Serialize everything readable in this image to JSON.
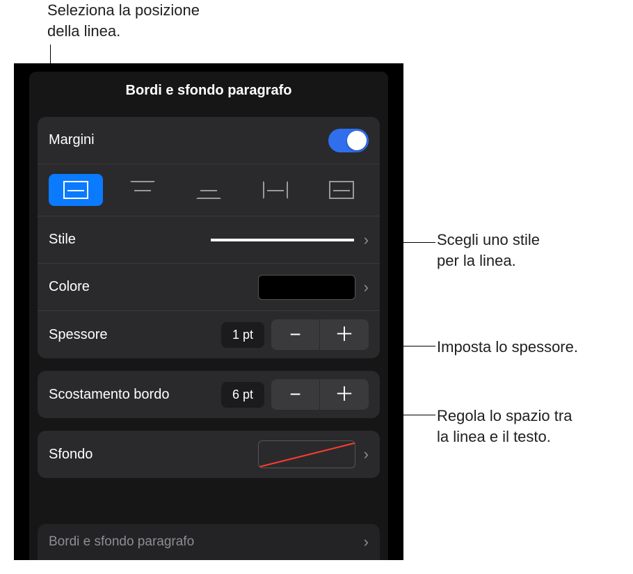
{
  "callouts": {
    "top": "Seleziona la posizione\ndella linea.",
    "style": "Scegli uno stile\nper la linea.",
    "thickness": "Imposta lo spessore.",
    "offset": "Regola lo spazio tra\nla linea e il testo."
  },
  "panel": {
    "title": "Bordi e sfondo paragrafo",
    "margins_label": "Margini",
    "margins_on": true,
    "positions": [
      "box",
      "top",
      "bottom",
      "left-right",
      "all"
    ],
    "selected_position_index": 0,
    "style_label": "Stile",
    "color_label": "Colore",
    "color_value": "#000000",
    "thickness_label": "Spessore",
    "thickness_value": "1 pt",
    "offset_label": "Scostamento bordo",
    "offset_value": "6 pt",
    "background_label": "Sfondo",
    "bottom_bar_label": "Bordi e sfondo paragrafo"
  },
  "glyphs": {
    "chevron_right": "›",
    "minus": "−",
    "plus": "＋"
  }
}
